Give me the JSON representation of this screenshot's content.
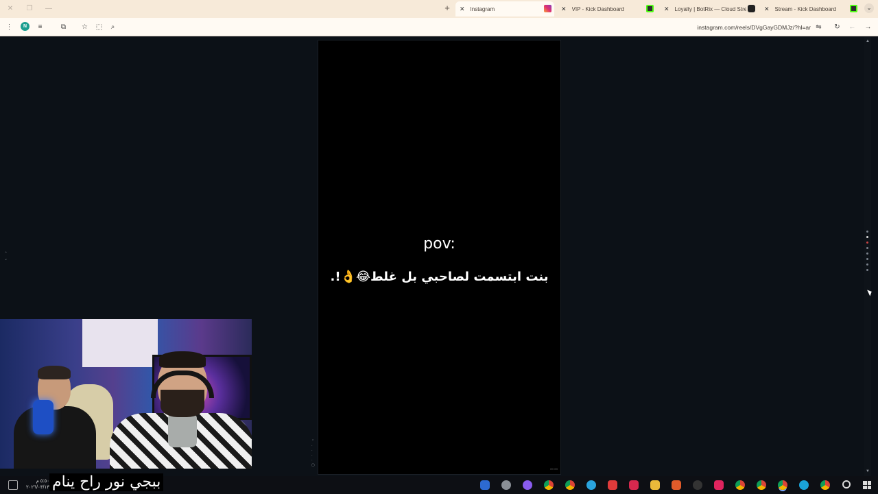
{
  "browser": {
    "tabs": [
      {
        "title": "Instagram",
        "active": true
      },
      {
        "title": "VIP - Kick Dashboard",
        "active": false
      },
      {
        "title": "Loyalty | BotRix — Cloud Stream",
        "active": false
      },
      {
        "title": "Stream - Kick Dashboard",
        "active": false
      }
    ],
    "new_tab_label": "+",
    "url": "instagram.com/reels/DVgGayGDMJz/?hl=ar",
    "profile_initial": "N"
  },
  "reel": {
    "pov_text": "pov:",
    "caption": "بنت ابتسمت لصاحبي بل غلط😂👌!."
  },
  "overlay": {
    "subtitle": "ببجي نور راح ينام"
  },
  "taskbar": {
    "time": "٥:٥٠ م",
    "date": "٢٠٢٦/٠٣/١٣"
  },
  "colors": {
    "tabstrip_bg": "#f7ead9",
    "page_bg": "#0c1117",
    "reel_bg": "#000000"
  }
}
